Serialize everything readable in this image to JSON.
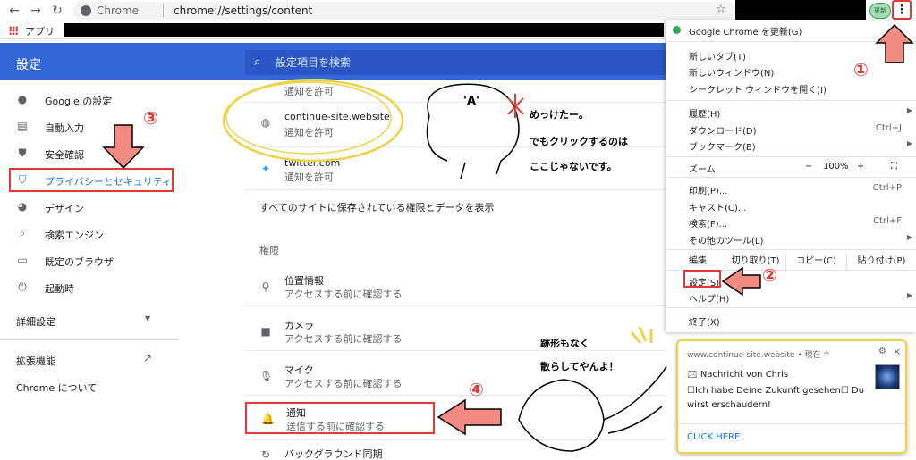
{
  "browser": {
    "omnibox_label": "Chrome",
    "url": "chrome://settings/content",
    "update_label": "更新",
    "bookmarks_apps": "アプリ"
  },
  "header": {
    "title": "設定",
    "search_placeholder": "設定項目を検索"
  },
  "sidebar": {
    "items": [
      {
        "label": "Google の設定",
        "icon": "person-icon"
      },
      {
        "label": "自動入力",
        "icon": "clipboard-icon"
      },
      {
        "label": "安全確認",
        "icon": "shield-check-icon"
      },
      {
        "label": "プライバシーとセキュリティ",
        "icon": "shield-icon"
      },
      {
        "label": "デザイン",
        "icon": "palette-icon"
      },
      {
        "label": "検索エンジン",
        "icon": "search-icon"
      },
      {
        "label": "既定のブラウザ",
        "icon": "browser-icon"
      },
      {
        "label": "起動時",
        "icon": "power-icon"
      }
    ],
    "advanced": "詳細設定",
    "extensions": "拡張機能",
    "about": "Chrome について"
  },
  "content": {
    "sites": [
      {
        "title": "",
        "sub": "通知を許可"
      },
      {
        "title": "continue-site.website",
        "sub": "通知を許可"
      },
      {
        "title": "twitter.com",
        "sub": "通知を許可"
      }
    ],
    "all_sites": "すべてのサイトに保存されている権限とデータを表示",
    "permissions_heading": "権限",
    "permissions": [
      {
        "title": "位置情報",
        "sub": "アクセスする前に確認する"
      },
      {
        "title": "カメラ",
        "sub": "アクセスする前に確認する"
      },
      {
        "title": "マイク",
        "sub": "アクセスする前に確認する"
      },
      {
        "title": "通知",
        "sub": "送信する前に確認する"
      },
      {
        "title": "バックグラウンド同期",
        "sub": ""
      }
    ]
  },
  "menu": {
    "update": "Google Chrome を更新(G)",
    "new_tab": "新しいタブ(T)",
    "new_window": "新しいウィンドウ(N)",
    "incognito": "シークレット ウィンドウを開く(I)",
    "history": "履歴(H)",
    "downloads": "ダウンロード(D)",
    "downloads_short": "Ctrl+J",
    "bookmarks": "ブックマーク(B)",
    "zoom": "ズーム",
    "zoom_minus": "−",
    "zoom_value": "100%",
    "zoom_plus": "+",
    "print": "印刷(P)...",
    "print_short": "Ctrl+P",
    "cast": "キャスト(C)...",
    "find": "検索(F)...",
    "find_short": "Ctrl+F",
    "more_tools": "その他のツール(L)",
    "edit": "編集",
    "cut": "切り取り(T)",
    "copy": "コピー(C)",
    "paste": "貼り付け(P)",
    "settings": "設定(S)",
    "help": "ヘルプ(H)",
    "exit": "終了(X)"
  },
  "notification": {
    "site": "www.continue-site.website • 現在 ^",
    "title": "🖂 Nachricht von Chris",
    "body": "☐Ich habe Deine Zukunft gesehen☐ Du wirst erschaudern!",
    "action": "CLICK HERE"
  },
  "annotations": {
    "note1": "めっけたー。",
    "note2": "でもクリックするのは",
    "note3": "ここじゃないです。",
    "note4": "跡形もなく",
    "note5": "散らしてやんよ！",
    "face_a": "'A'",
    "num1": "①",
    "num2": "②",
    "num3": "③",
    "num4": "④"
  },
  "colors": {
    "header_blue": "#3367d6",
    "accent_blue": "#1a73e8",
    "annotation_red": "#e53935",
    "highlight_yellow": "#f0d24a"
  }
}
